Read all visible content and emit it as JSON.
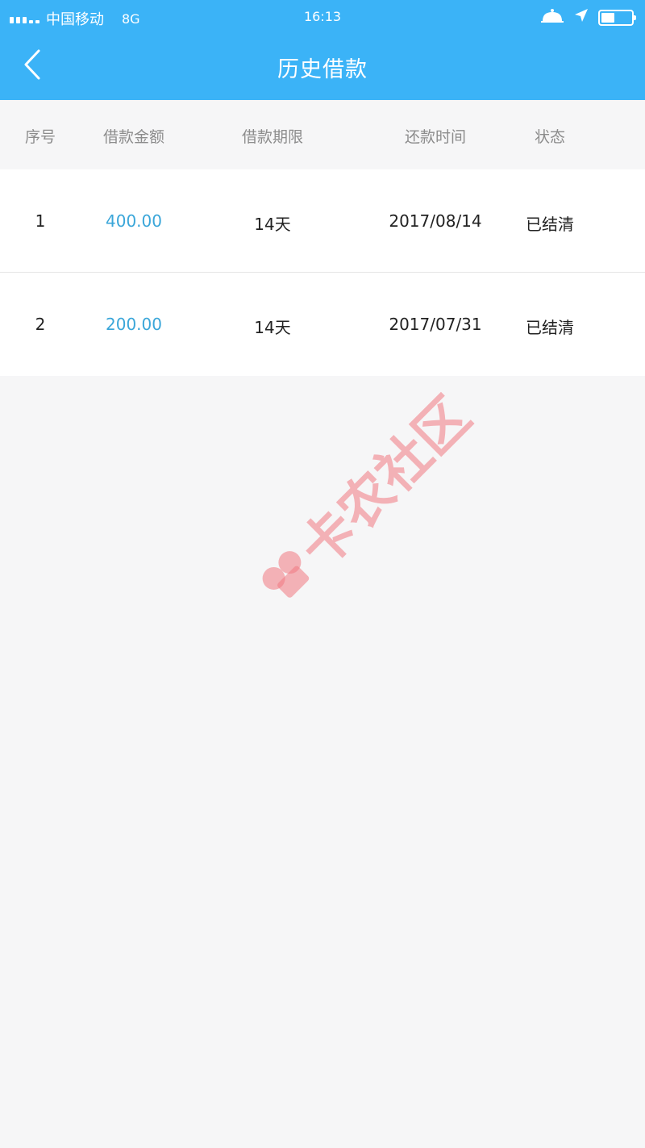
{
  "status_bar": {
    "carrier": "中国移动",
    "network": "8G",
    "time": "16:13",
    "icons": [
      "signal-icon",
      "alarm-bell-icon",
      "location-arrow-icon",
      "battery-icon"
    ]
  },
  "nav": {
    "title": "历史借款",
    "back_icon": "chevron-left-icon"
  },
  "table": {
    "headers": [
      "序号",
      "借款金额",
      "借款期限",
      "还款时间",
      "状态"
    ],
    "rows": [
      {
        "index": "1",
        "amount": "400.00",
        "term": "14天",
        "repay_date": "2017/08/14",
        "status": "已结清"
      },
      {
        "index": "2",
        "amount": "200.00",
        "term": "14天",
        "repay_date": "2017/07/31",
        "status": "已结清"
      }
    ]
  },
  "watermark": {
    "text": "卡农社区"
  },
  "colors": {
    "header_bg": "#3bb3f7",
    "amount": "#3aa6d9",
    "page_bg": "#f6f6f7",
    "watermark": "#f07882"
  }
}
